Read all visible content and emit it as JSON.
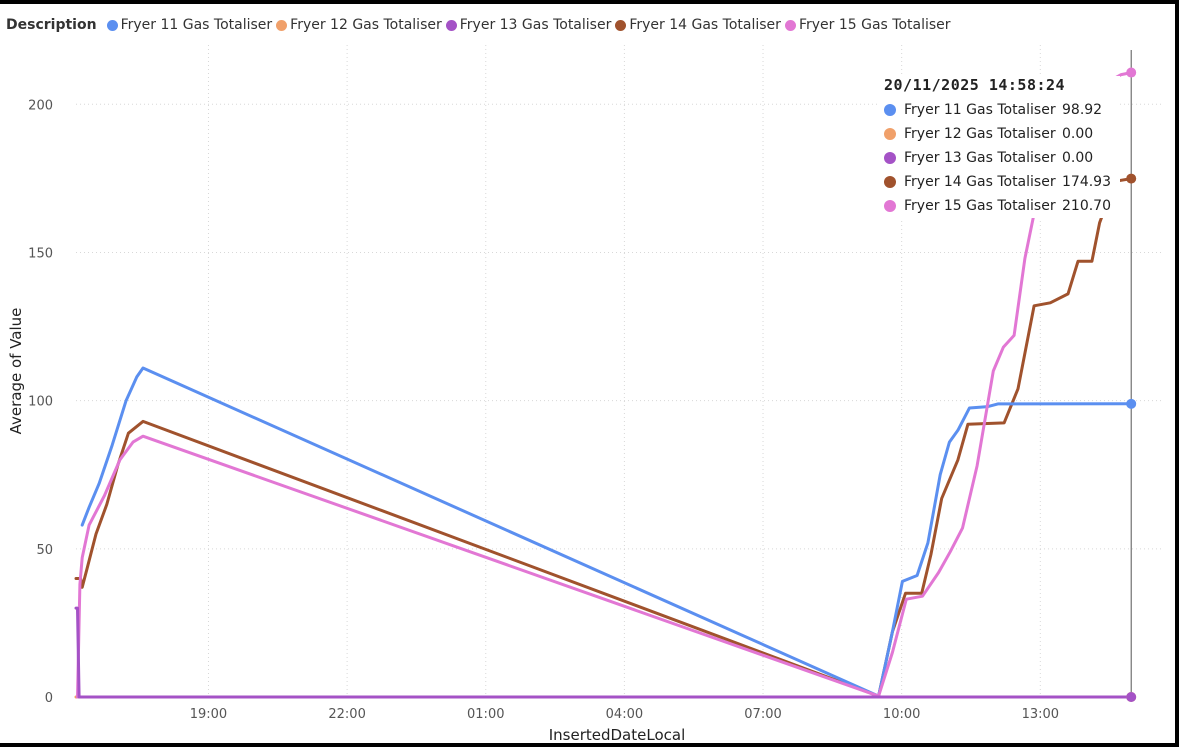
{
  "legend": {
    "title": "Description",
    "items": [
      {
        "label": "Fryer 11 Gas Totaliser",
        "color": "#5B8FF0"
      },
      {
        "label": "Fryer 12 Gas Totaliser",
        "color": "#F0A06A"
      },
      {
        "label": "Fryer 13 Gas Totaliser",
        "color": "#A452C6"
      },
      {
        "label": "Fryer 14 Gas Totaliser",
        "color": "#A0522D"
      },
      {
        "label": "Fryer 15 Gas Totaliser",
        "color": "#E277D4"
      }
    ]
  },
  "tooltip": {
    "title": "20/11/2025 14:58:24",
    "rows": [
      {
        "label": "Fryer 11 Gas Totaliser",
        "value": "98.92",
        "color": "#5B8FF0"
      },
      {
        "label": "Fryer 12 Gas Totaliser",
        "value": "0.00",
        "color": "#F0A06A"
      },
      {
        "label": "Fryer 13 Gas Totaliser",
        "value": "0.00",
        "color": "#A452C6"
      },
      {
        "label": "Fryer 14 Gas Totaliser",
        "value": "174.93",
        "color": "#A0522D"
      },
      {
        "label": "Fryer 15 Gas Totaliser",
        "value": "210.70",
        "color": "#E277D4"
      }
    ]
  },
  "chart_data": {
    "type": "line",
    "xlabel": "InsertedDateLocal",
    "ylabel": "Average of Value",
    "xlim": [
      "19/11/2025 16:08",
      "20/11/2025 15:38"
    ],
    "ylim": [
      0,
      220
    ],
    "grid": true,
    "legend_position": "top-left",
    "x_ticks": [
      "19:00",
      "22:00",
      "01:00",
      "04:00",
      "07:00",
      "10:00",
      "13:00"
    ],
    "y_ticks": [
      0,
      50,
      100,
      150,
      200
    ],
    "series": [
      {
        "name": "Fryer 11 Gas Totaliser",
        "color": "#5B8FF0",
        "points": [
          [
            "19/11/2025 16:16",
            58
          ],
          [
            "19/11/2025 16:25",
            64
          ],
          [
            "19/11/2025 16:38",
            72
          ],
          [
            "19/11/2025 16:55",
            85
          ],
          [
            "19/11/2025 17:13",
            100
          ],
          [
            "19/11/2025 17:27",
            108
          ],
          [
            "19/11/2025 17:35",
            111
          ],
          [
            "20/11/2025 09:30",
            0.3
          ],
          [
            "20/11/2025 09:48",
            22
          ],
          [
            "20/11/2025 10:01",
            39
          ],
          [
            "20/11/2025 10:20",
            41
          ],
          [
            "20/11/2025 10:34",
            52
          ],
          [
            "20/11/2025 10:50",
            75
          ],
          [
            "20/11/2025 11:02",
            86
          ],
          [
            "20/11/2025 11:13",
            90
          ],
          [
            "20/11/2025 11:28",
            97.5
          ],
          [
            "20/11/2025 11:52",
            98
          ],
          [
            "20/11/2025 12:05",
            98.9
          ],
          [
            "20/11/2025 14:58",
            98.92
          ]
        ]
      },
      {
        "name": "Fryer 12 Gas Totaliser",
        "color": "#F0A06A",
        "points": [
          [
            "19/11/2025 16:08",
            0
          ],
          [
            "20/11/2025 14:58",
            0
          ]
        ]
      },
      {
        "name": "Fryer 13 Gas Totaliser",
        "color": "#A452C6",
        "points": [
          [
            "19/11/2025 16:08",
            30
          ],
          [
            "19/11/2025 16:10",
            30
          ],
          [
            "19/11/2025 16:12",
            0
          ],
          [
            "20/11/2025 14:58",
            0
          ]
        ]
      },
      {
        "name": "Fryer 14 Gas Totaliser",
        "color": "#A0522D",
        "points": [
          [
            "19/11/2025 16:08",
            40
          ],
          [
            "19/11/2025 16:14",
            40
          ],
          [
            "19/11/2025 16:16",
            37
          ],
          [
            "19/11/2025 16:22",
            43
          ],
          [
            "19/11/2025 16:28",
            49
          ],
          [
            "19/11/2025 16:34",
            55
          ],
          [
            "19/11/2025 16:48",
            65
          ],
          [
            "19/11/2025 17:02",
            78
          ],
          [
            "19/11/2025 17:16",
            89
          ],
          [
            "19/11/2025 17:35",
            93
          ],
          [
            "20/11/2025 09:30",
            0.3
          ],
          [
            "20/11/2025 09:48",
            22
          ],
          [
            "20/11/2025 10:05",
            35
          ],
          [
            "20/11/2025 10:26",
            35
          ],
          [
            "20/11/2025 10:38",
            48
          ],
          [
            "20/11/2025 10:52",
            67
          ],
          [
            "20/11/2025 11:13",
            80
          ],
          [
            "20/11/2025 11:26",
            92
          ],
          [
            "20/11/2025 12:13",
            92.5
          ],
          [
            "20/11/2025 12:31",
            104
          ],
          [
            "20/11/2025 12:52",
            132
          ],
          [
            "20/11/2025 13:13",
            133
          ],
          [
            "20/11/2025 13:36",
            136
          ],
          [
            "20/11/2025 13:49",
            147
          ],
          [
            "20/11/2025 14:07",
            147
          ],
          [
            "20/11/2025 14:17",
            160
          ],
          [
            "20/11/2025 14:37",
            174
          ],
          [
            "20/11/2025 14:58",
            174.93
          ]
        ]
      },
      {
        "name": "Fryer 15 Gas Totaliser",
        "color": "#E277D4",
        "points": [
          [
            "19/11/2025 16:10",
            0
          ],
          [
            "19/11/2025 16:13",
            38
          ],
          [
            "19/11/2025 16:16",
            47
          ],
          [
            "19/11/2025 16:25",
            58
          ],
          [
            "19/11/2025 16:45",
            68
          ],
          [
            "19/11/2025 17:05",
            80
          ],
          [
            "19/11/2025 17:22",
            86
          ],
          [
            "19/11/2025 17:35",
            88
          ],
          [
            "20/11/2025 09:30",
            0.3
          ],
          [
            "20/11/2025 09:48",
            15
          ],
          [
            "20/11/2025 10:06",
            33
          ],
          [
            "20/11/2025 10:27",
            34
          ],
          [
            "20/11/2025 10:48",
            42
          ],
          [
            "20/11/2025 11:03",
            49
          ],
          [
            "20/11/2025 11:19",
            57
          ],
          [
            "20/11/2025 11:38",
            78
          ],
          [
            "20/11/2025 11:59",
            110
          ],
          [
            "20/11/2025 12:12",
            118
          ],
          [
            "20/11/2025 12:26",
            122
          ],
          [
            "20/11/2025 12:40",
            148
          ],
          [
            "20/11/2025 12:51",
            162
          ],
          [
            "20/11/2025 13:18",
            180
          ],
          [
            "20/11/2025 13:48",
            195
          ],
          [
            "20/11/2025 14:24",
            207
          ],
          [
            "20/11/2025 14:45",
            210
          ],
          [
            "20/11/2025 14:58",
            210.7
          ]
        ]
      }
    ]
  }
}
